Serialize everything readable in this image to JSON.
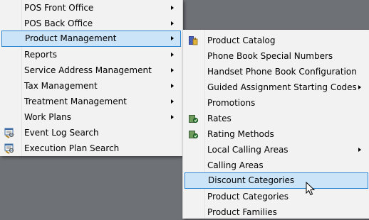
{
  "main_menu": {
    "items": [
      {
        "label": "POS Front Office",
        "submenu": true
      },
      {
        "label": "POS Back Office",
        "submenu": true
      },
      {
        "label": "Product Management",
        "submenu": true,
        "highlighted": true
      },
      {
        "label": "Reports",
        "submenu": true
      },
      {
        "label": "Service Address Management",
        "submenu": true
      },
      {
        "label": "Tax Management",
        "submenu": true
      },
      {
        "label": "Treatment Management",
        "submenu": true
      },
      {
        "label": "Work Plans",
        "submenu": true
      },
      {
        "label": "Event Log Search",
        "icon": "log-search-icon"
      },
      {
        "label": "Execution Plan Search",
        "icon": "plan-search-icon"
      }
    ]
  },
  "sub_menu": {
    "items": [
      {
        "label": "Product Catalog",
        "icon": "catalog-icon"
      },
      {
        "label": "Phone Book Special Numbers"
      },
      {
        "label": "Handset Phone Book Configuration"
      },
      {
        "label": "Guided Assignment Starting Codes",
        "submenu": true
      },
      {
        "label": "Promotions"
      },
      {
        "label": "Rates",
        "icon": "rates-icon"
      },
      {
        "label": "Rating Methods",
        "icon": "rating-methods-icon"
      },
      {
        "label": "Local Calling Areas",
        "submenu": true
      },
      {
        "label": "Calling Areas"
      },
      {
        "label": "Discount Categories",
        "highlighted": true
      },
      {
        "label": "Product Categories"
      },
      {
        "label": "Product Families"
      }
    ]
  },
  "colors": {
    "background": "#6e7176",
    "menu_bg": "#f2f2f2",
    "highlight_bg": "#cce4f7",
    "highlight_border": "#2f86d2"
  }
}
